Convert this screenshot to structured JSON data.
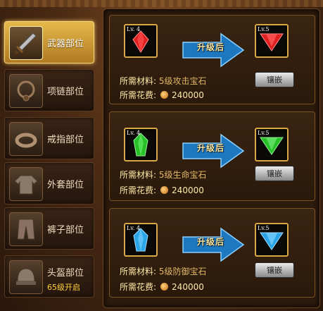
{
  "sidebar": {
    "items": [
      {
        "label": "武器部位",
        "icon": "sword-icon",
        "active": true
      },
      {
        "label": "项链部位",
        "icon": "necklace-icon"
      },
      {
        "label": "戒指部位",
        "icon": "ring-icon"
      },
      {
        "label": "外套部位",
        "icon": "coat-icon"
      },
      {
        "label": "裤子部位",
        "icon": "pants-icon"
      },
      {
        "label": "头盔部位",
        "sub": "65级开启",
        "icon": "helmet-icon"
      }
    ]
  },
  "upgrades": [
    {
      "from_level": "Lv. 4",
      "to_level": "Lv.5",
      "arrow_text": "升级后",
      "material_label": "所需材料:",
      "material": "5级攻击宝石",
      "cost_label": "所需花费:",
      "cost": "240000",
      "button": "镶嵌",
      "gem_color": "#e02020",
      "gem_type": "red-gem-icon"
    },
    {
      "from_level": "Lv. 4",
      "to_level": "Lv.5",
      "arrow_text": "升级后",
      "material_label": "所需材料:",
      "material": "5级生命宝石",
      "cost_label": "所需花费:",
      "cost": "240000",
      "button": "镶嵌",
      "gem_color": "#28c028",
      "gem_type": "green-gem-icon"
    },
    {
      "from_level": "Lv. 4",
      "to_level": "Lv.5",
      "arrow_text": "升级后",
      "material_label": "所需材料:",
      "material": "5级防御宝石",
      "cost_label": "所需花费:",
      "cost": "240000",
      "button": "镶嵌",
      "gem_color": "#2aa6e8",
      "gem_type": "blue-gem-icon"
    }
  ]
}
